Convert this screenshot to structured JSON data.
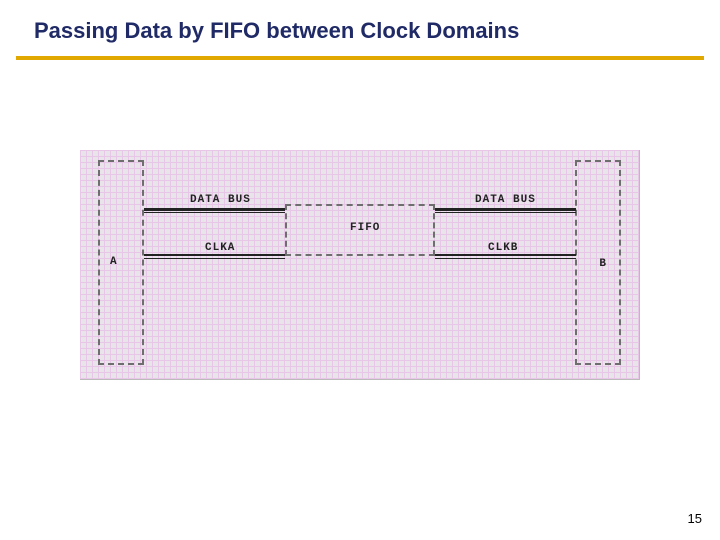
{
  "title": "Passing Data by FIFO between Clock Domains",
  "page_number": "15",
  "diagram": {
    "blocks": {
      "a_label": "A",
      "b_label": "B",
      "fifo_label": "FIFO"
    },
    "signals": {
      "data_bus_left": "DATA BUS",
      "data_bus_right": "DATA BUS",
      "clka": "CLKA",
      "clkb": "CLKB"
    }
  }
}
